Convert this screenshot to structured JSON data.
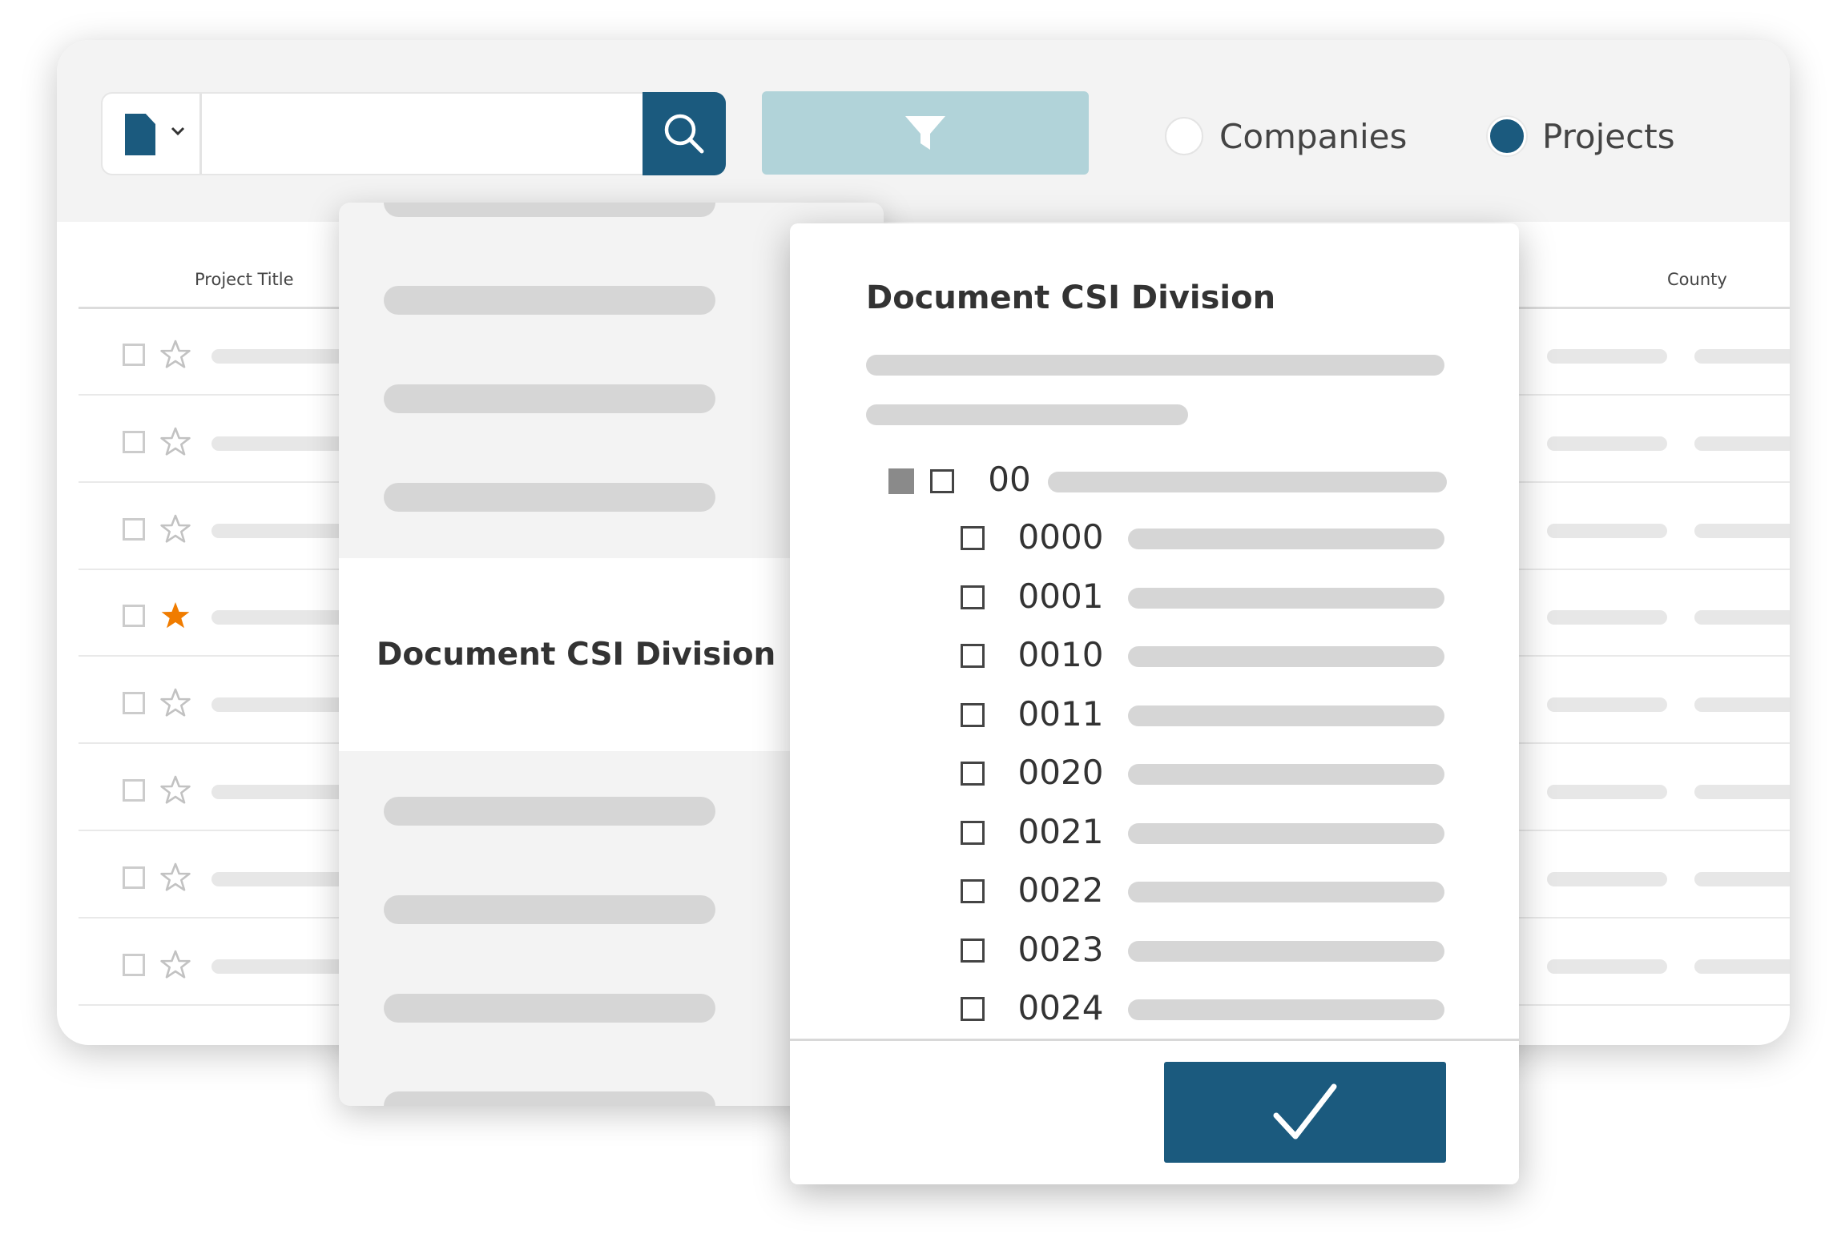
{
  "toolbar": {
    "search_placeholder": "",
    "radio_options": [
      {
        "label": "Companies",
        "selected": false
      },
      {
        "label": "Projects",
        "selected": true
      }
    ]
  },
  "table": {
    "columns": [
      "Project Title",
      "County"
    ],
    "starred": [
      false,
      false,
      false,
      true,
      false,
      false,
      false,
      false
    ]
  },
  "mid_panel": {
    "selected_label": "Document CSI Division"
  },
  "front_panel": {
    "title": "Document CSI Division",
    "parent": {
      "code": "00",
      "state": "partial"
    },
    "children": [
      "0000",
      "0001",
      "0010",
      "0011",
      "0020",
      "0021",
      "0022",
      "0023",
      "0024"
    ]
  },
  "colors": {
    "primary": "#1b5a7e",
    "filter": "#b1d3d9",
    "star_active": "#f07c00",
    "placeholder_bar": "#d6d6d6"
  },
  "icons": {
    "type_select": "document-icon",
    "search": "search-icon",
    "filter": "filter-icon",
    "confirm": "checkmark-icon"
  }
}
